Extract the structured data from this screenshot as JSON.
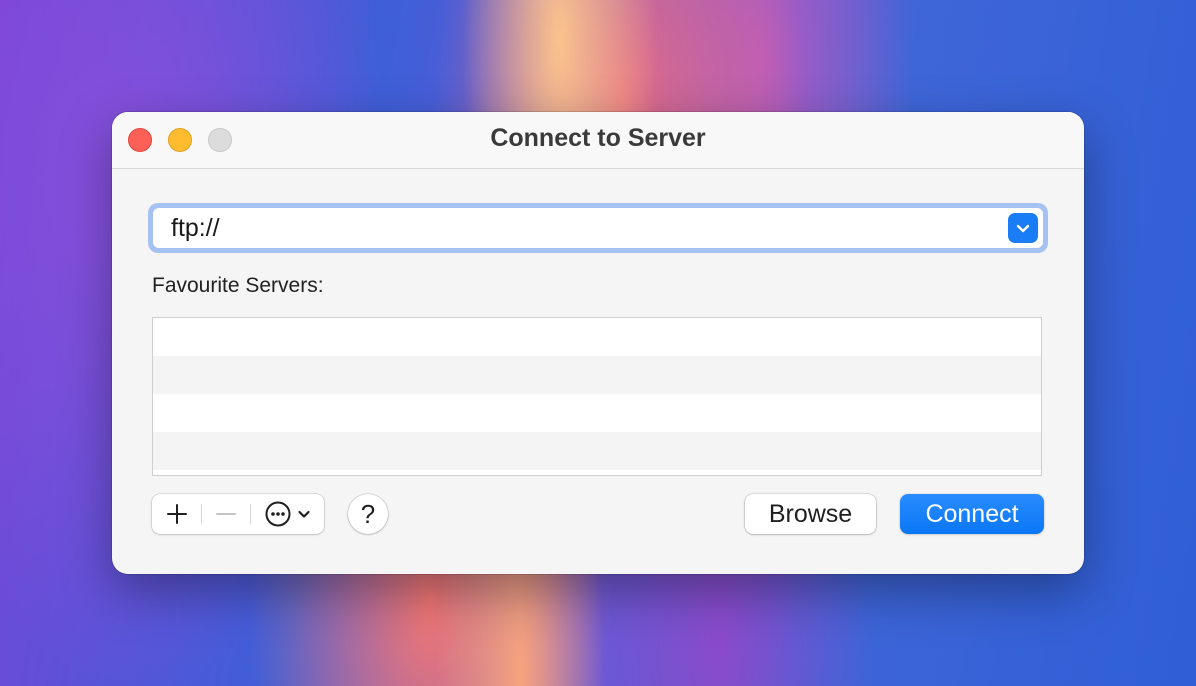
{
  "window": {
    "title": "Connect to Server",
    "traffic_lights": {
      "close_color": "#fe5f57",
      "minimize_color": "#febc2e",
      "zoom_color": "#dcdcdc"
    }
  },
  "address": {
    "value": "ftp://",
    "dropdown_icon": "chevron-down-icon",
    "accent_color": "#1b7df5"
  },
  "favourites": {
    "label": "Favourite Servers:",
    "items": []
  },
  "toolbar": {
    "add_icon": "plus-icon",
    "remove_icon": "minus-icon",
    "more_icon": "ellipsis-circle-icon",
    "more_menu_icon": "chevron-down-icon",
    "help_label": "?"
  },
  "buttons": {
    "browse_label": "Browse",
    "connect_label": "Connect",
    "connect_color": "#0a77f5"
  }
}
